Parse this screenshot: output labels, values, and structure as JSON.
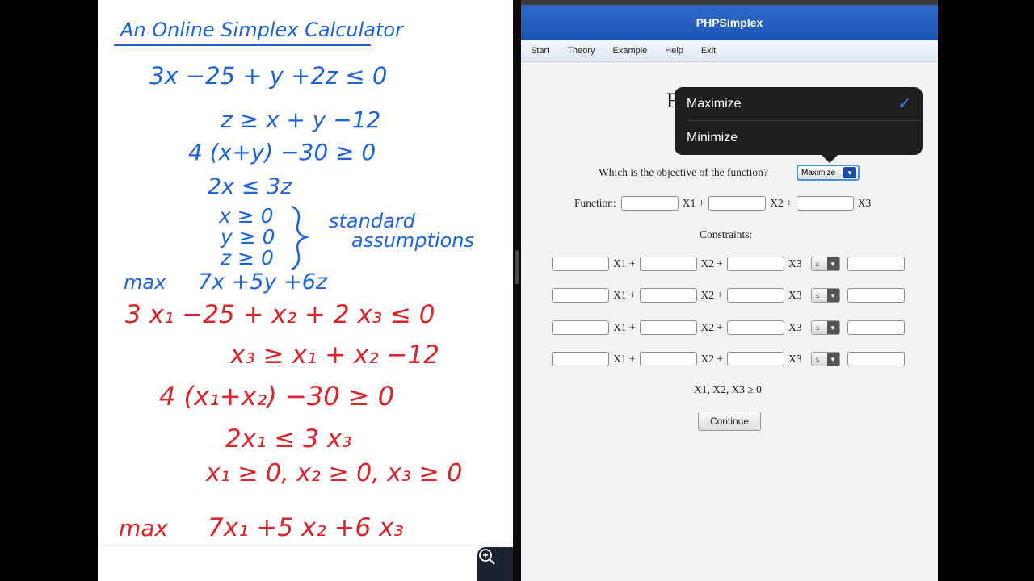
{
  "notes": {
    "title": "An Online Simplex Calculator",
    "blue_lines": [
      "3x −25 + y +2z ≤ 0",
      "z ≥ x + y −12",
      "4 (x+y) −30 ≥ 0",
      "2x ≤ 3z",
      "x ≥ 0",
      "y ≥ 0",
      "z ≥ 0",
      "standard",
      "assumptions",
      "max",
      "7x +5y +6z"
    ],
    "red_lines": [
      "3 x₁ −25 + x₂ + 2 x₃ ≤ 0",
      "x₃ ≥ x₁ + x₂ −12",
      "4 (x₁+x₂) −30 ≥ 0",
      "2x₁ ≤ 3 x₃",
      "x₁ ≥ 0, x₂ ≥ 0, x₃ ≥ 0",
      "max",
      "7x₁ +5 x₂ +6 x₃"
    ],
    "colors": {
      "blue": "#1f63d8",
      "red": "#d9252b"
    },
    "zoom_icon": "zoom-in-icon"
  },
  "app": {
    "title": "PHPSimplex",
    "menu": [
      "Start",
      "Theory",
      "Example",
      "Help",
      "Exit"
    ],
    "heading_partial": "F",
    "objective_question": "Which is the objective of the function?",
    "objective_value": "Maximize",
    "dropdown_options": [
      "Maximize",
      "Minimize"
    ],
    "selected_option": "Maximize",
    "function_label": "Function:",
    "var_labels": {
      "x1": "X1 +",
      "x2": "X2 +",
      "x3": "X3"
    },
    "constraints_label": "Constraints:",
    "constraint_rows": [
      {
        "sign": "≤"
      },
      {
        "sign": "≤"
      },
      {
        "sign": "≤"
      },
      {
        "sign": "≤"
      }
    ],
    "nonneg": "X1, X2, X3 ≥ 0",
    "continue_label": "Continue",
    "colors": {
      "titlebar": "#2462c2",
      "check": "#3f86f5"
    }
  }
}
